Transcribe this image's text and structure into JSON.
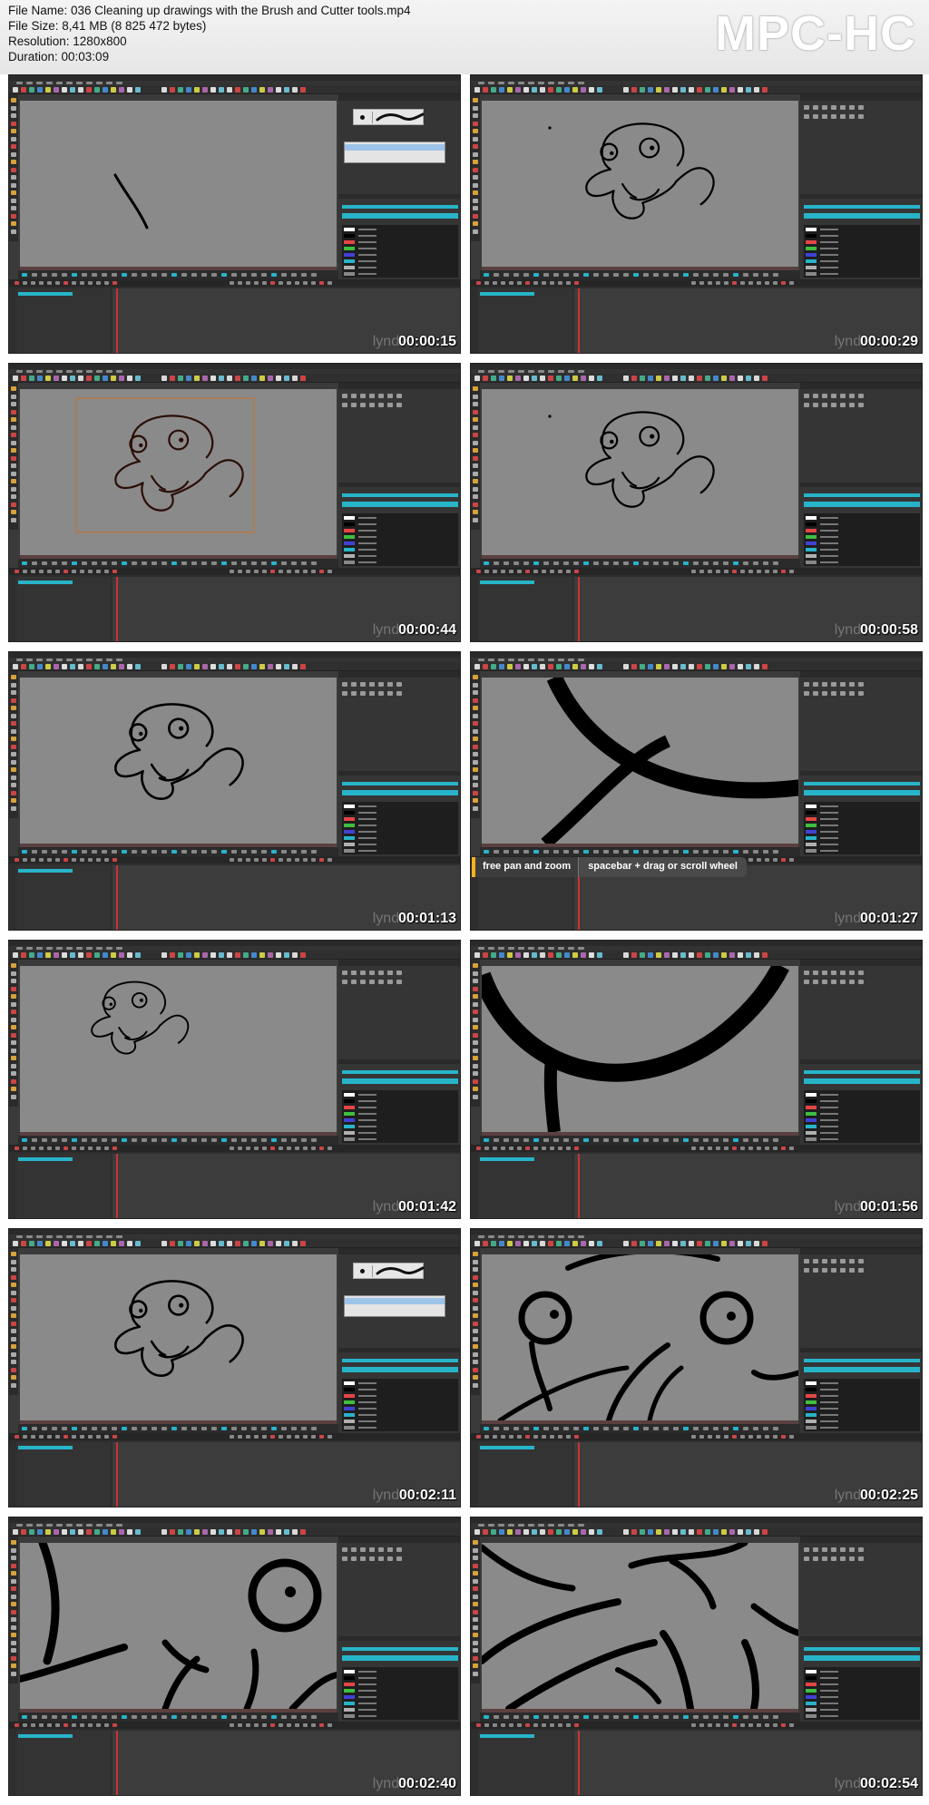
{
  "header": {
    "file_name": "File Name: 036 Cleaning up drawings with the Brush and Cutter tools.mp4",
    "file_size": "File Size: 8,41 MB (8 825 472 bytes)",
    "resolution": "Resolution: 1280x800",
    "duration": "Duration: 00:03:09",
    "brand": "MPC-HC"
  },
  "watermark": "lynda",
  "hint": {
    "action": "free pan and zoom",
    "shortcut": "spacebar + drag or scroll wheel"
  },
  "colors": {
    "canvas": "#8a8a8a",
    "cyan_accent": "#27b4c9",
    "hint_accent": "#f6b21d"
  },
  "frames": [
    {
      "timestamp": "00:00:15",
      "scene": "stroke"
    },
    {
      "timestamp": "00:00:29",
      "scene": "squid"
    },
    {
      "timestamp": "00:00:44",
      "scene": "squid-selected"
    },
    {
      "timestamp": "00:00:58",
      "scene": "squid"
    },
    {
      "timestamp": "00:01:13",
      "scene": "squid-clean"
    },
    {
      "timestamp": "00:01:27",
      "scene": "zoom-cross"
    },
    {
      "timestamp": "00:01:42",
      "scene": "squid-small"
    },
    {
      "timestamp": "00:01:56",
      "scene": "zoom-curve"
    },
    {
      "timestamp": "00:02:11",
      "scene": "squid-clean"
    },
    {
      "timestamp": "00:02:25",
      "scene": "zoom-face"
    },
    {
      "timestamp": "00:02:40",
      "scene": "zoom-eye"
    },
    {
      "timestamp": "00:02:54",
      "scene": "zoom-mouth"
    }
  ]
}
